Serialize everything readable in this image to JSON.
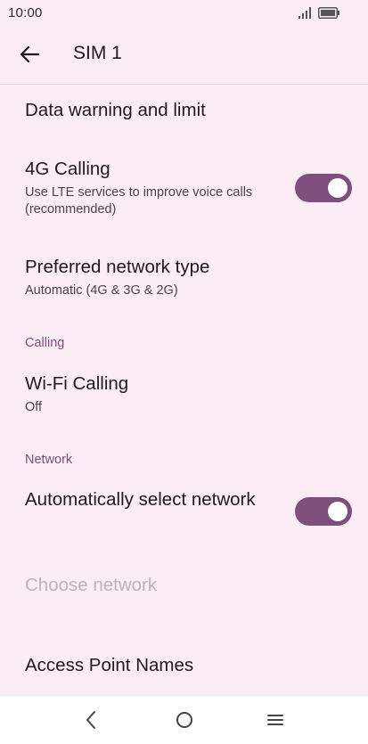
{
  "status_bar": {
    "time": "10:00",
    "icons": [
      "signal-icon",
      "battery-icon"
    ]
  },
  "app_bar": {
    "title": "SIM 1",
    "back_icon": "arrow-left-icon"
  },
  "items": {
    "data_warning": {
      "title": "Data warning and limit"
    },
    "four_g_calling": {
      "title": "4G Calling",
      "subtitle": "Use LTE services to improve voice calls (recommended)",
      "toggle_on": true
    },
    "preferred_network": {
      "title": "Preferred network type",
      "subtitle": "Automatic (4G & 3G & 2G)"
    },
    "calling_header": "Calling",
    "wifi_calling": {
      "title": "Wi-Fi Calling",
      "subtitle": "Off"
    },
    "network_header": "Network",
    "auto_select": {
      "title": "Automatically select network",
      "toggle_on": true
    },
    "choose_network": {
      "title": "Choose network",
      "disabled": true
    },
    "apn": {
      "title": "Access Point Names"
    }
  },
  "nav_bar": {
    "icons": [
      "nav-back-icon",
      "nav-home-icon",
      "nav-menu-icon"
    ]
  },
  "colors": {
    "background": "#fcecf5",
    "accent": "#7e4f7d",
    "disabled_text": "#bdb3ba"
  }
}
